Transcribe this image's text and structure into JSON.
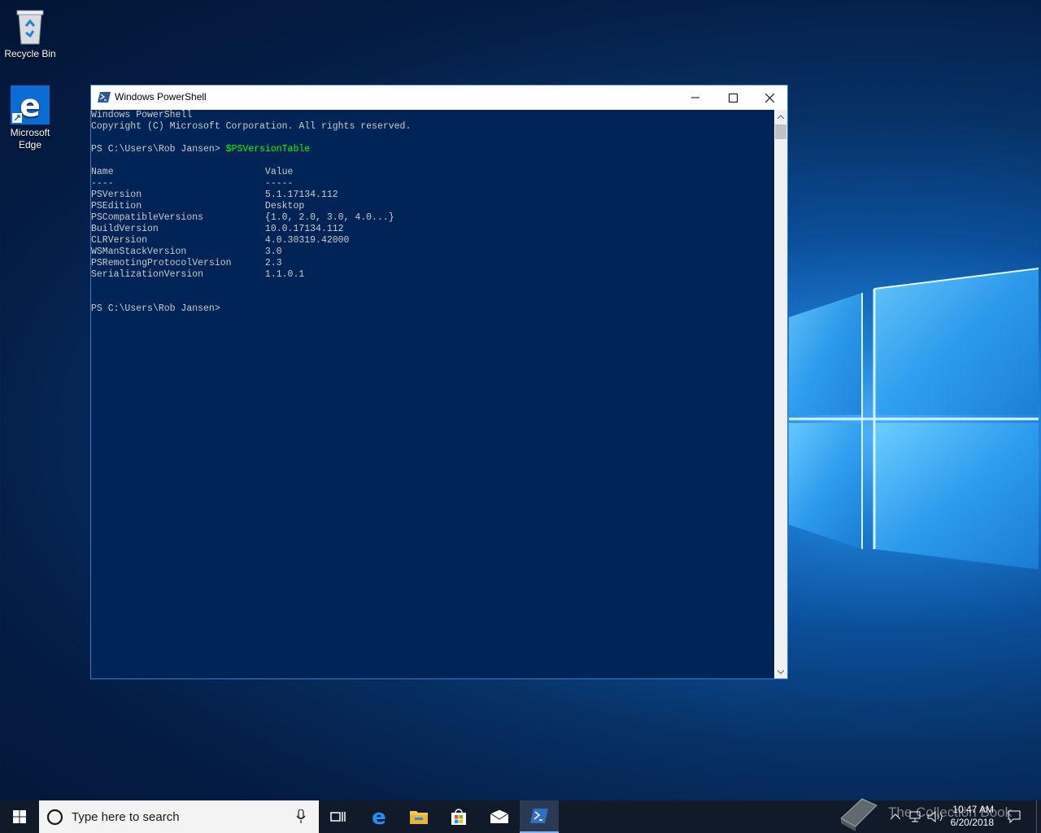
{
  "desktop": {
    "recycle_bin_label": "Recycle Bin",
    "edge_label_line1": "Microsoft",
    "edge_label_line2": "Edge"
  },
  "window": {
    "title": "Windows PowerShell",
    "console_lines": [
      "Windows PowerShell",
      "Copyright (C) Microsoft Corporation. All rights reserved.",
      "",
      {
        "prompt": "PS C:\\Users\\Rob Jansen> ",
        "command": "$PSVersionTable"
      },
      "",
      "Name                           Value",
      "----                           -----",
      "PSVersion                      5.1.17134.112",
      "PSEdition                      Desktop",
      "PSCompatibleVersions           {1.0, 2.0, 3.0, 4.0...}",
      "BuildVersion                   10.0.17134.112",
      "CLRVersion                     4.0.30319.42000",
      "WSManStackVersion              3.0",
      "PSRemotingProtocolVersion      2.3",
      "SerializationVersion           1.1.0.1",
      "",
      "",
      "PS C:\\Users\\Rob Jansen>"
    ]
  },
  "taskbar": {
    "search_placeholder": "Type here to search",
    "clock_time": "10:47 AM",
    "clock_date": "6/20/2018",
    "watermark": "The Collection Book"
  },
  "colors": {
    "console_bg": "#012456",
    "console_text": "#cccccc",
    "command_text": "#00ff00",
    "taskbar_bg": "#101a28"
  }
}
